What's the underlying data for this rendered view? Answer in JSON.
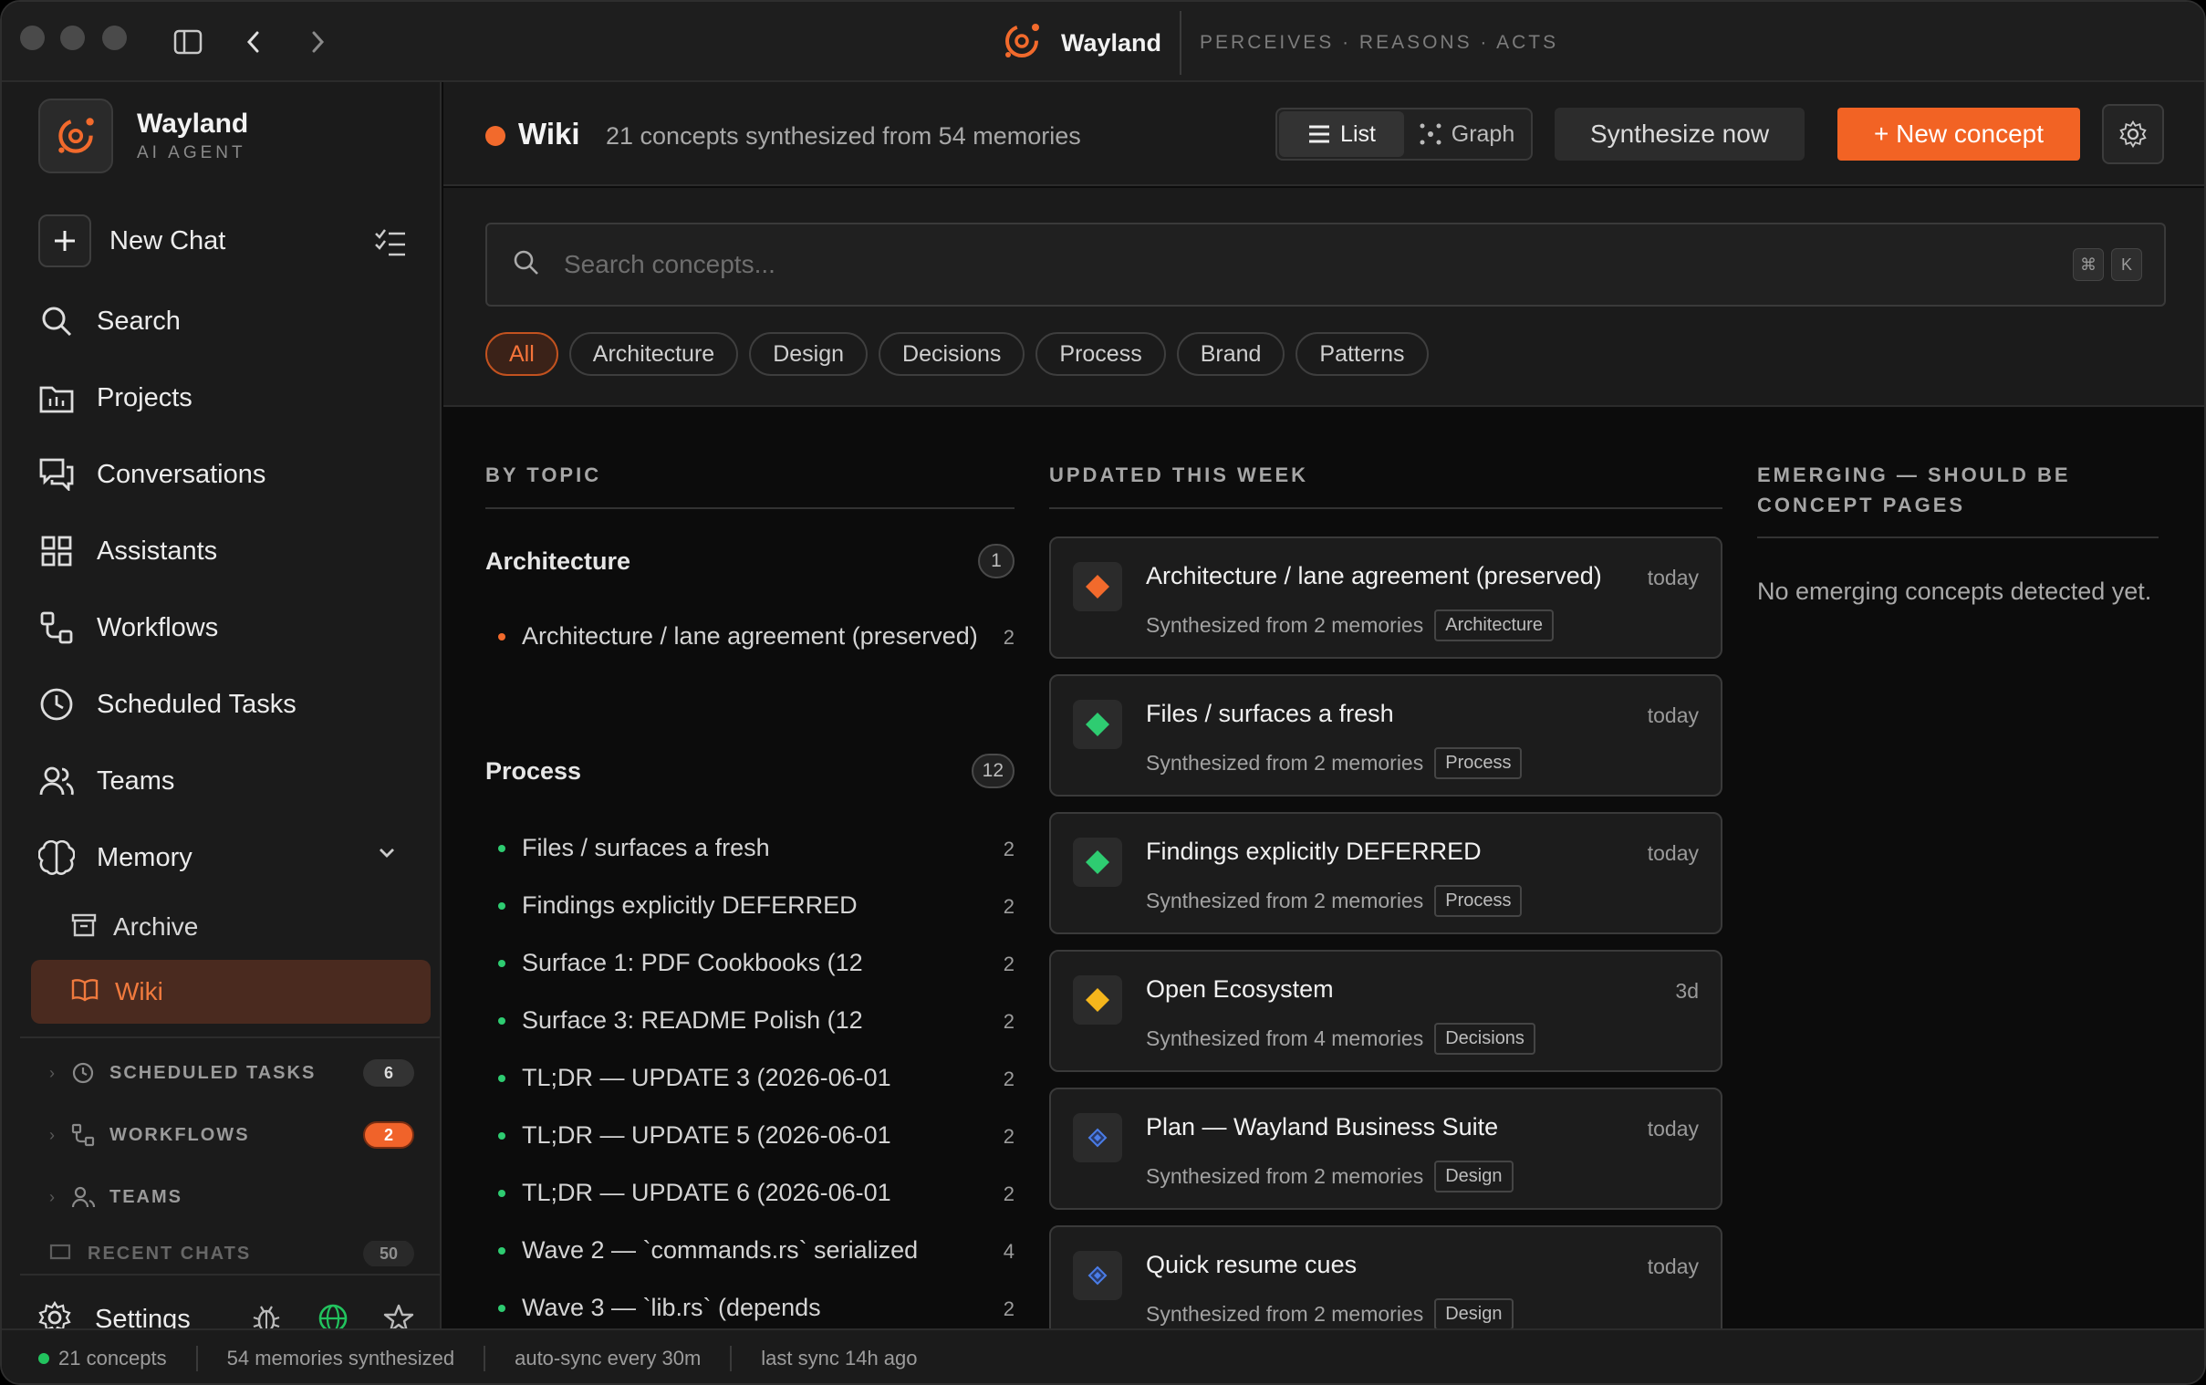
{
  "titlebar": {
    "app_name": "Wayland",
    "tagline": "PERCEIVES · REASONS · ACTS"
  },
  "sidebar": {
    "brand_name": "Wayland",
    "brand_sub": "AI AGENT",
    "new_chat": "New Chat",
    "items": [
      {
        "label": "Search",
        "icon": "search-icon"
      },
      {
        "label": "Projects",
        "icon": "folder-icon"
      },
      {
        "label": "Conversations",
        "icon": "chat-icon"
      },
      {
        "label": "Assistants",
        "icon": "grid-icon"
      },
      {
        "label": "Workflows",
        "icon": "workflow-icon"
      },
      {
        "label": "Scheduled Tasks",
        "icon": "clock-icon"
      },
      {
        "label": "Teams",
        "icon": "users-icon"
      },
      {
        "label": "Memory",
        "icon": "brain-icon"
      }
    ],
    "memory_sub": [
      {
        "label": "Archive",
        "icon": "archive-icon"
      },
      {
        "label": "Wiki",
        "icon": "book-icon"
      }
    ],
    "sections": [
      {
        "label": "SCHEDULED TASKS",
        "count": "6"
      },
      {
        "label": "WORKFLOWS",
        "count": "2"
      },
      {
        "label": "TEAMS",
        "count": ""
      },
      {
        "label": "RECENT CHATS",
        "count": "50"
      }
    ],
    "settings": "Settings",
    "accent": "#f26a2c"
  },
  "header": {
    "title": "Wiki",
    "subtitle": "21 concepts synthesized from 54 memories",
    "view_list": "List",
    "view_graph": "Graph",
    "synthesize": "Synthesize now",
    "new_concept": "+ New concept"
  },
  "search": {
    "placeholder": "Search concepts...",
    "kbd1": "⌘",
    "kbd2": "K"
  },
  "filters": [
    "All",
    "Architecture",
    "Design",
    "Decisions",
    "Process",
    "Brand",
    "Patterns"
  ],
  "columns": {
    "by_topic": "BY TOPIC",
    "updated": "UPDATED THIS WEEK",
    "emerging_line1": "EMERGING — SHOULD BE",
    "emerging_line2": "CONCEPT PAGES",
    "emerging_empty": "No emerging concepts detected yet."
  },
  "topics": [
    {
      "name": "Architecture",
      "count": "1",
      "items": [
        {
          "text": "Architecture / lane agreement (preserved)",
          "n": "2",
          "color": "#f26a2c"
        }
      ]
    },
    {
      "name": "Process",
      "count": "12",
      "items": [
        {
          "text": "Files / surfaces a fresh",
          "n": "2",
          "color": "#2ecc71"
        },
        {
          "text": "Findings explicitly DEFERRED",
          "n": "2",
          "color": "#2ecc71"
        },
        {
          "text": "Surface 1: PDF Cookbooks (12",
          "n": "2",
          "color": "#2ecc71"
        },
        {
          "text": "Surface 3: README Polish (12",
          "n": "2",
          "color": "#2ecc71"
        },
        {
          "text": "TL;DR — UPDATE 3 (2026-06-01",
          "n": "2",
          "color": "#2ecc71"
        },
        {
          "text": "TL;DR — UPDATE 5 (2026-06-01",
          "n": "2",
          "color": "#2ecc71"
        },
        {
          "text": "TL;DR — UPDATE 6 (2026-06-01",
          "n": "2",
          "color": "#2ecc71"
        },
        {
          "text": "Wave 2 — `commands.rs` serialized",
          "n": "4",
          "color": "#2ecc71"
        },
        {
          "text": "Wave 3 — `lib.rs` (depends",
          "n": "2",
          "color": "#2ecc71"
        }
      ]
    }
  ],
  "updated_cards": [
    {
      "title": "Architecture / lane agreement (preserved)",
      "when": "today",
      "meta": "Synthesized from 2 memories",
      "tag": "Architecture",
      "gem_color": "#f26a2c",
      "gem_size": "large"
    },
    {
      "title": "Files / surfaces a fresh",
      "when": "today",
      "meta": "Synthesized from 2 memories",
      "tag": "Process",
      "gem_color": "#2ecc71",
      "gem_size": "large"
    },
    {
      "title": "Findings explicitly DEFERRED",
      "when": "today",
      "meta": "Synthesized from 2 memories",
      "tag": "Process",
      "gem_color": "#2ecc71",
      "gem_size": "large"
    },
    {
      "title": "Open Ecosystem",
      "when": "3d",
      "meta": "Synthesized from 4 memories",
      "tag": "Decisions",
      "gem_color": "#f5b61c",
      "gem_size": "large"
    },
    {
      "title": "Plan — Wayland Business Suite",
      "when": "today",
      "meta": "Synthesized from 2 memories",
      "tag": "Design",
      "gem_color": "#4a7de8",
      "gem_size": "small"
    },
    {
      "title": "Quick resume cues",
      "when": "today",
      "meta": "Synthesized from 2 memories",
      "tag": "Design",
      "gem_color": "#4a7de8",
      "gem_size": "small"
    }
  ],
  "statusbar": {
    "concepts": "21 concepts",
    "memories": "54 memories synthesized",
    "autosync": "auto-sync every 30m",
    "last_sync": "last sync 14h ago"
  }
}
